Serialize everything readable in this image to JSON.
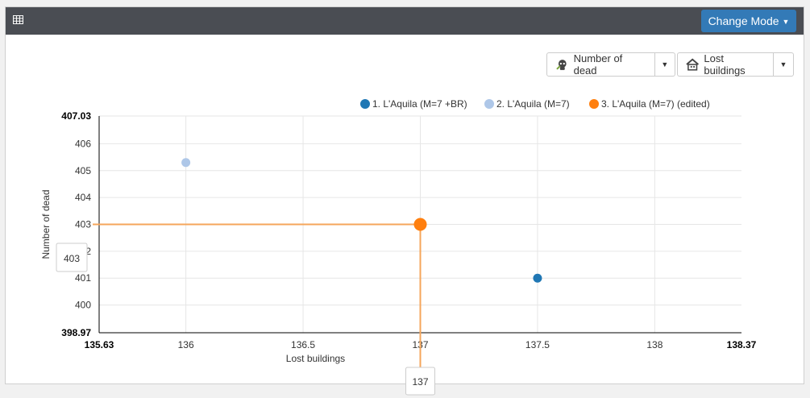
{
  "toolbar": {
    "grid_icon": "table-grid-icon",
    "mode_button_label": "Change Mode",
    "y_select": {
      "label": "Number of dead",
      "icon": "skull-icon"
    },
    "x_select": {
      "label": "Lost buildings",
      "icon": "house-icon"
    }
  },
  "chart_data": {
    "type": "scatter",
    "xlabel": "Lost buildings",
    "ylabel": "Number of dead",
    "xlim": [
      135.63,
      138.37
    ],
    "ylim": [
      398.97,
      407.03
    ],
    "x_ticks": [
      "135.63",
      "136",
      "136.5",
      "137",
      "137.5",
      "138",
      "138.37"
    ],
    "y_ticks": [
      "398.97",
      "400",
      "401",
      "402",
      "403",
      "404",
      "405",
      "406",
      "407.03"
    ],
    "legend_position": "top",
    "series": [
      {
        "name": "1. L'Aquila (M=7 +BR)",
        "color": "#1f77b4",
        "points": [
          {
            "x": 137.5,
            "y": 401
          }
        ]
      },
      {
        "name": "2. L'Aquila (M=7)",
        "color": "#aec7e8",
        "points": [
          {
            "x": 136,
            "y": 405.3
          }
        ]
      },
      {
        "name": "3. L'Aquila (M=7) (edited)",
        "color": "#ff7f0e",
        "points": [
          {
            "x": 137,
            "y": 403
          }
        ]
      }
    ],
    "crosshair": {
      "x": 137,
      "y": 403,
      "x_label": "137",
      "y_label": "403",
      "color": "#f5a65b"
    }
  }
}
